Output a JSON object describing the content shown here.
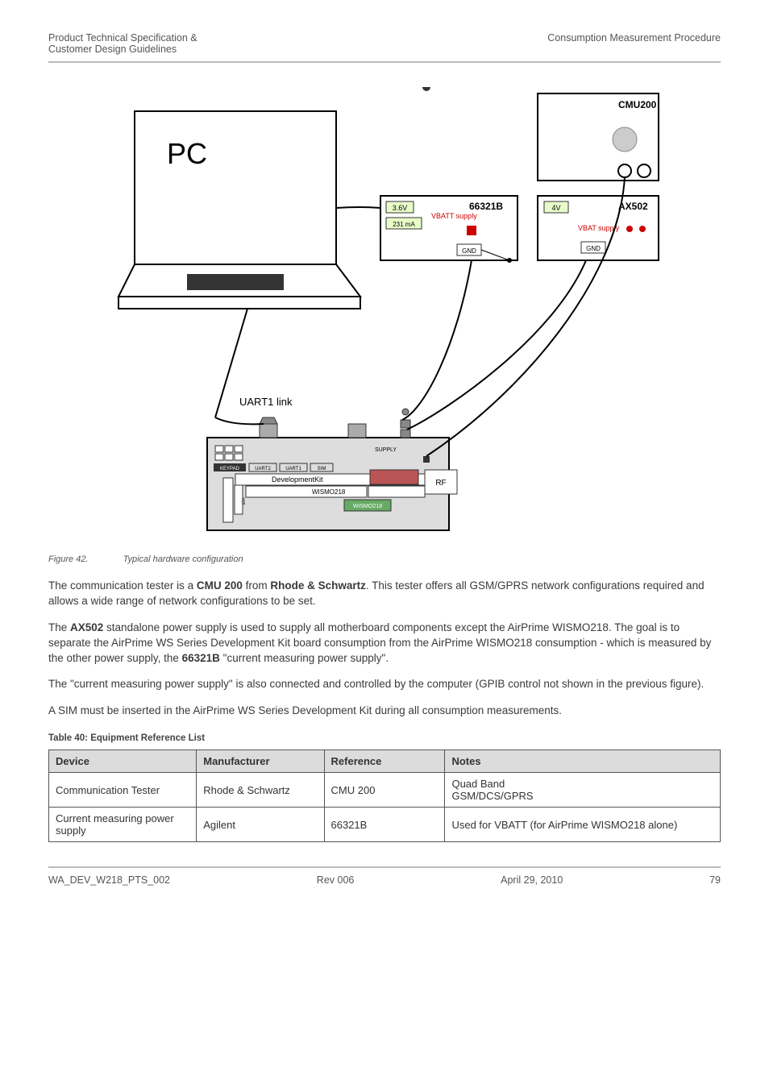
{
  "header": {
    "left_line1": "Product Technical Specification &",
    "left_line2": "Customer Design Guidelines",
    "right": "Consumption Measurement Procedure"
  },
  "figure": {
    "number": "Figure 42.",
    "title": "Typical hardware configuration",
    "labels": {
      "pc": "PC",
      "cmu200": "CMU200",
      "ax502": "AX502",
      "voltage_4v": "4V",
      "vbat_supply": "VBAT supply",
      "gnd1": "GND",
      "gnd2": "GND",
      "b66321": "66321B",
      "voltage_3_6v": "3.6V",
      "amp_231": "231 mA",
      "vbatt_supply": "VBATT supply",
      "uart1": "UART1 link",
      "rf": "RF",
      "devkit": "DevelopmentKit",
      "wismo1": "WISMO218",
      "wismo2": "WISMO218",
      "keypad": "KEYPAD",
      "uart2s": "UART2",
      "uart1s": "UART1",
      "sim": "SIM",
      "supply": "SUPPLY",
      "cnsptn": "cnspntn",
      "sim2": "sim"
    }
  },
  "paragraphs": {
    "p1_a": "The communication tester is a ",
    "p1_b": "CMU 200",
    "p1_c": " from ",
    "p1_d": "Rhode & Schwartz",
    "p1_e": ". This tester offers all GSM/GPRS network configurations required and allows a wide range of network configurations to be set.",
    "p2_a": "The ",
    "p2_b": "AX502",
    "p2_c": " standalone power supply is used to supply all motherboard components except the AirPrime WISMO218. The goal is to separate the AirPrime WS Series Development Kit board consumption from the AirPrime WISMO218 consumption - which is measured by the other power supply, the ",
    "p2_d": "66321B",
    "p2_e": " \"current measuring power supply\".",
    "p3": "The \"current measuring power supply\" is also connected and controlled by the computer (GPIB control not shown in the previous figure).",
    "p4": "A SIM must be inserted in the AirPrime WS Series Development Kit during all consumption measurements."
  },
  "table": {
    "title": "Table 40:   Equipment Reference List",
    "headers": [
      "Device",
      "Manufacturer",
      "Reference",
      "Notes"
    ],
    "rows": [
      [
        "Communication Tester",
        "Rhode & Schwartz",
        "CMU 200",
        "Quad Band\nGSM/DCS/GPRS"
      ],
      [
        "Current measuring power supply",
        "Agilent",
        "66321B",
        "Used for VBATT (for AirPrime WISMO218 alone)"
      ]
    ]
  },
  "footer": {
    "left": "WA_DEV_W218_PTS_002",
    "center": "Rev 006",
    "right": "April 29, 2010",
    "page": "79"
  }
}
